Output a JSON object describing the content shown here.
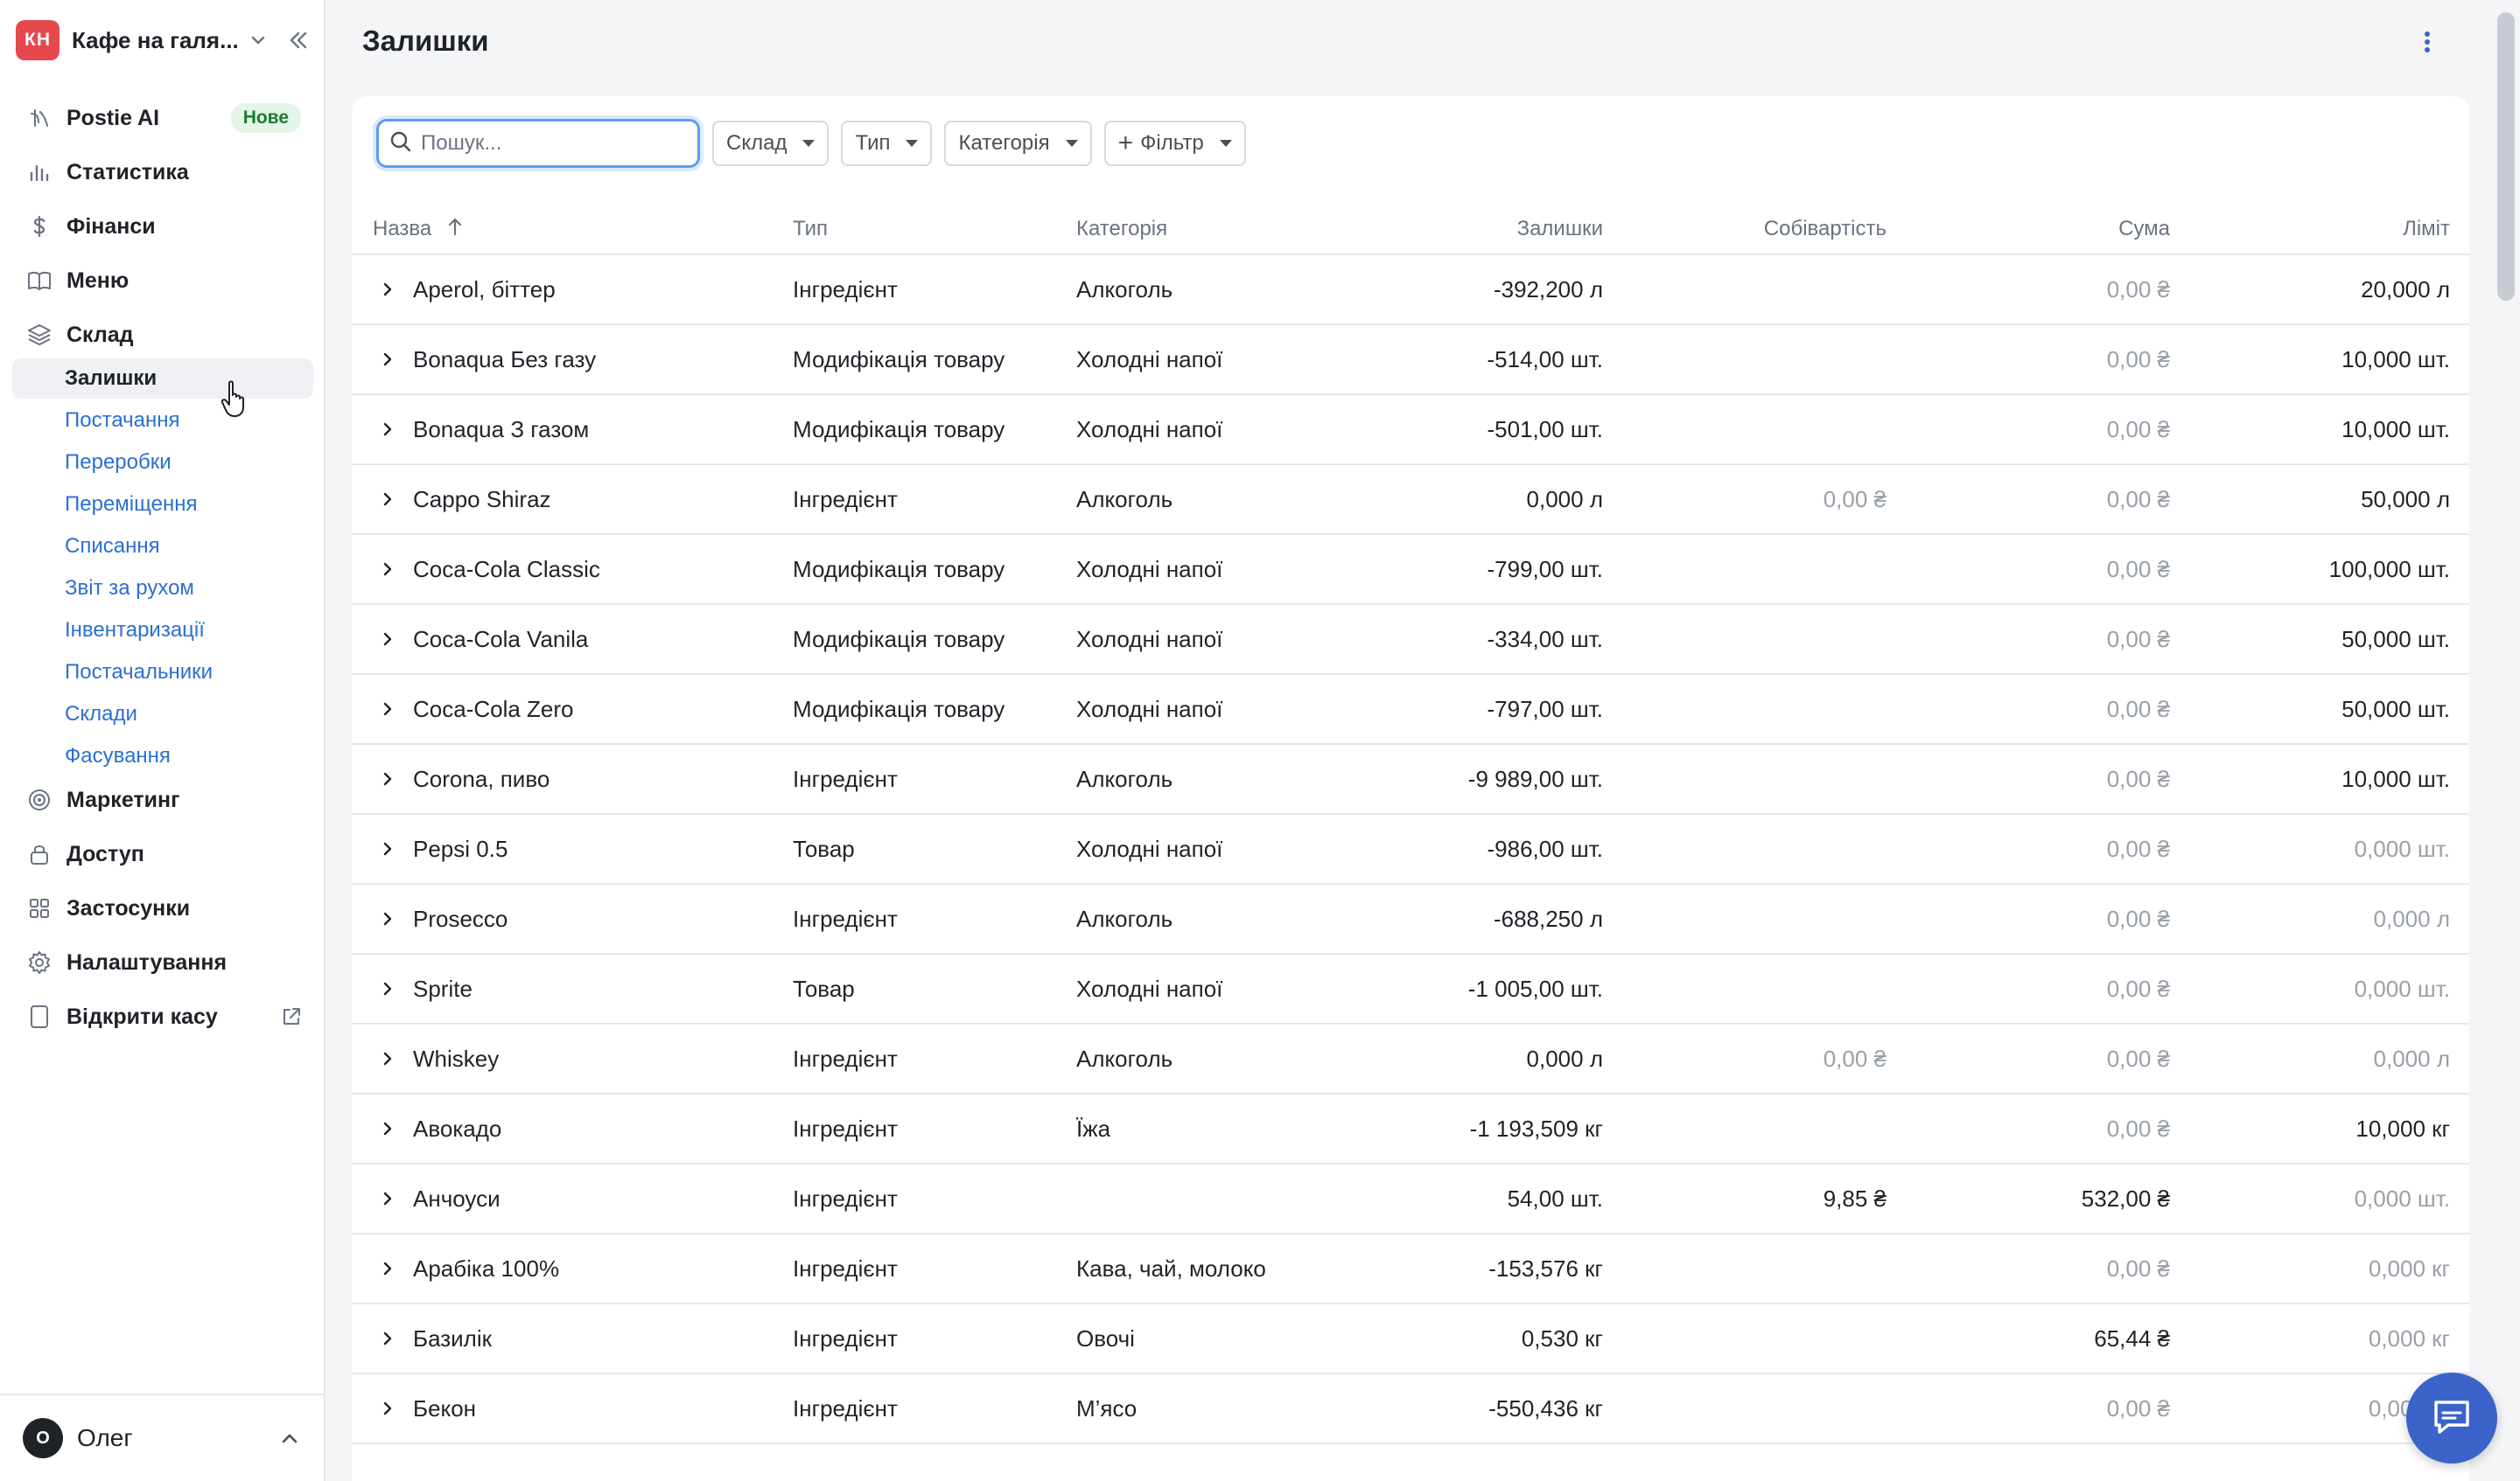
{
  "account": {
    "initials": "КН",
    "name": "Кафе на галя..."
  },
  "nav": {
    "postie_ai": "Postie AI",
    "postie_badge": "Нове",
    "statistics": "Статистика",
    "finance": "Фінанси",
    "menu": "Меню",
    "warehouse": "Склад",
    "sub": [
      "Залишки",
      "Постачання",
      "Переробки",
      "Переміщення",
      "Списання",
      "Звіт за рухом",
      "Інвентаризації",
      "Постачальники",
      "Склади",
      "Фасування"
    ],
    "marketing": "Маркетинг",
    "access": "Доступ",
    "apps": "Застосунки",
    "settings": "Налаштування",
    "open_register": "Відкрити касу"
  },
  "user": {
    "initial": "О",
    "name": "Олег"
  },
  "page": {
    "title": "Залишки"
  },
  "toolbar": {
    "search_placeholder": "Пошук...",
    "filter_warehouse": "Склад",
    "filter_type": "Тип",
    "filter_category": "Категорія",
    "filter_more": "Фільтр"
  },
  "table": {
    "columns": {
      "name": "Назва",
      "type": "Тип",
      "category": "Категорія",
      "stock": "Залишки",
      "cost": "Собівартість",
      "sum": "Сума",
      "limit": "Ліміт"
    },
    "rows": [
      {
        "name": "Aperol, біттер",
        "type": "Інгредієнт",
        "category": "Алкоголь",
        "stock": "-392,200 л",
        "cost": "",
        "sum": "0,00 ₴",
        "sum_muted": true,
        "limit": "20,000 л",
        "limit_muted": false
      },
      {
        "name": "Bonaqua Без газу",
        "type": "Модифікація товару",
        "category": "Холодні напої",
        "stock": "-514,00 шт.",
        "cost": "",
        "sum": "0,00 ₴",
        "sum_muted": true,
        "limit": "10,000 шт.",
        "limit_muted": false
      },
      {
        "name": "Bonaqua З газом",
        "type": "Модифікація товару",
        "category": "Холодні напої",
        "stock": "-501,00 шт.",
        "cost": "",
        "sum": "0,00 ₴",
        "sum_muted": true,
        "limit": "10,000 шт.",
        "limit_muted": false
      },
      {
        "name": "Cappo Shiraz",
        "type": "Інгредієнт",
        "category": "Алкоголь",
        "stock": "0,000 л",
        "cost": "0,00 ₴",
        "cost_muted": true,
        "sum": "0,00 ₴",
        "sum_muted": true,
        "limit": "50,000 л",
        "limit_muted": false
      },
      {
        "name": "Coca-Cola Classic",
        "type": "Модифікація товару",
        "category": "Холодні напої",
        "stock": "-799,00 шт.",
        "cost": "",
        "sum": "0,00 ₴",
        "sum_muted": true,
        "limit": "100,000 шт.",
        "limit_muted": false
      },
      {
        "name": "Coca-Cola Vanila",
        "type": "Модифікація товару",
        "category": "Холодні напої",
        "stock": "-334,00 шт.",
        "cost": "",
        "sum": "0,00 ₴",
        "sum_muted": true,
        "limit": "50,000 шт.",
        "limit_muted": false
      },
      {
        "name": "Coca-Cola Zero",
        "type": "Модифікація товару",
        "category": "Холодні напої",
        "stock": "-797,00 шт.",
        "cost": "",
        "sum": "0,00 ₴",
        "sum_muted": true,
        "limit": "50,000 шт.",
        "limit_muted": false
      },
      {
        "name": "Corona, пиво",
        "type": "Інгредієнт",
        "category": "Алкоголь",
        "stock": "-9 989,00 шт.",
        "cost": "",
        "sum": "0,00 ₴",
        "sum_muted": true,
        "limit": "10,000 шт.",
        "limit_muted": false
      },
      {
        "name": "Pepsi 0.5",
        "type": "Товар",
        "category": "Холодні напої",
        "stock": "-986,00 шт.",
        "cost": "",
        "sum": "0,00 ₴",
        "sum_muted": true,
        "limit": "0,000 шт.",
        "limit_muted": true
      },
      {
        "name": "Prosecco",
        "type": "Інгредієнт",
        "category": "Алкоголь",
        "stock": "-688,250 л",
        "cost": "",
        "sum": "0,00 ₴",
        "sum_muted": true,
        "limit": "0,000 л",
        "limit_muted": true
      },
      {
        "name": "Sprite",
        "type": "Товар",
        "category": "Холодні напої",
        "stock": "-1 005,00 шт.",
        "cost": "",
        "sum": "0,00 ₴",
        "sum_muted": true,
        "limit": "0,000 шт.",
        "limit_muted": true
      },
      {
        "name": "Whiskey",
        "type": "Інгредієнт",
        "category": "Алкоголь",
        "stock": "0,000 л",
        "cost": "0,00 ₴",
        "cost_muted": true,
        "sum": "0,00 ₴",
        "sum_muted": true,
        "limit": "0,000 л",
        "limit_muted": true
      },
      {
        "name": "Авокадо",
        "type": "Інгредієнт",
        "category": "Їжа",
        "stock": "-1 193,509 кг",
        "cost": "",
        "sum": "0,00 ₴",
        "sum_muted": true,
        "limit": "10,000 кг",
        "limit_muted": false
      },
      {
        "name": "Анчоуси",
        "type": "Інгредієнт",
        "category": "",
        "stock": "54,00 шт.",
        "cost": "9,85 ₴",
        "cost_muted": false,
        "sum": "532,00 ₴",
        "sum_muted": false,
        "limit": "0,000 шт.",
        "limit_muted": true
      },
      {
        "name": "Арабіка 100%",
        "type": "Інгредієнт",
        "category": "Кава, чай, молоко",
        "stock": "-153,576 кг",
        "cost": "",
        "sum": "0,00 ₴",
        "sum_muted": true,
        "limit": "0,000 кг",
        "limit_muted": true
      },
      {
        "name": "Базилік",
        "type": "Інгредієнт",
        "category": "Овочі",
        "stock": "0,530 кг",
        "cost": "",
        "sum": "65,44 ₴",
        "sum_muted": false,
        "limit": "0,000 кг",
        "limit_muted": true
      },
      {
        "name": "Бекон",
        "type": "Інгредієнт",
        "category": "М’ясо",
        "stock": "-550,436 кг",
        "cost": "",
        "sum": "0,00 ₴",
        "sum_muted": true,
        "limit": "0,000 кг",
        "limit_muted": true
      }
    ]
  }
}
